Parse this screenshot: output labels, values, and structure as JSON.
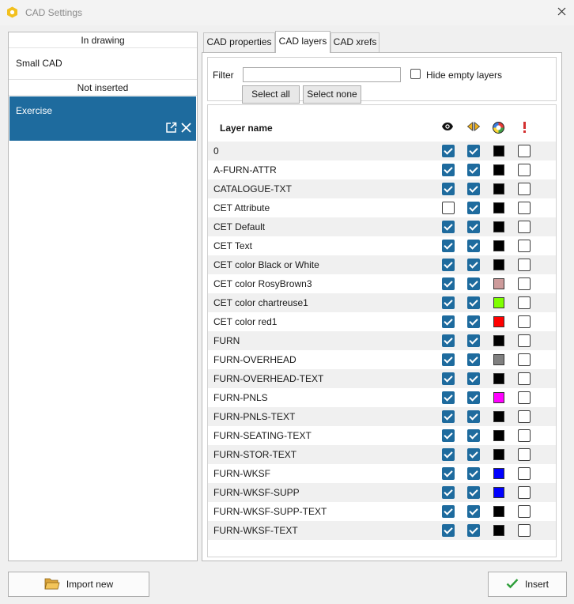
{
  "window": {
    "title": "CAD Settings",
    "icon": "hexagon-app-icon"
  },
  "left_panel": {
    "sections": [
      {
        "header": "In drawing",
        "items": [
          "Small CAD"
        ]
      },
      {
        "header": "Not inserted",
        "selected_item": "Exercise"
      }
    ],
    "selected_actions": [
      "external-link-icon",
      "close-icon"
    ]
  },
  "tabs": [
    {
      "label": "CAD properties",
      "active": false
    },
    {
      "label": "CAD layers",
      "active": true
    },
    {
      "label": "CAD xrefs",
      "active": false
    }
  ],
  "filter": {
    "label": "Filter",
    "value": "",
    "hide_empty_label": "Hide empty layers",
    "hide_empty_checked": false,
    "select_all_label": "Select all",
    "select_none_label": "Select none"
  },
  "layer_table": {
    "header_name": "Layer name",
    "header_icons": [
      "eye-icon",
      "freeze-icon",
      "color-wheel-icon",
      "warning-icon"
    ],
    "rows": [
      {
        "name": "0",
        "visible": true,
        "frozen": true,
        "color": "#000000",
        "warn": false
      },
      {
        "name": "A-FURN-ATTR",
        "visible": true,
        "frozen": true,
        "color": "#000000",
        "warn": false
      },
      {
        "name": "CATALOGUE-TXT",
        "visible": true,
        "frozen": true,
        "color": "#000000",
        "warn": false
      },
      {
        "name": "CET Attribute",
        "visible": false,
        "frozen": true,
        "color": "#000000",
        "warn": false
      },
      {
        "name": "CET Default",
        "visible": true,
        "frozen": true,
        "color": "#000000",
        "warn": false
      },
      {
        "name": "CET Text",
        "visible": true,
        "frozen": true,
        "color": "#000000",
        "warn": false
      },
      {
        "name": "CET color Black or White",
        "visible": true,
        "frozen": true,
        "color": "#000000",
        "warn": false
      },
      {
        "name": "CET color RosyBrown3",
        "visible": true,
        "frozen": true,
        "color": "#cd9b9b",
        "warn": false
      },
      {
        "name": "CET color chartreuse1",
        "visible": true,
        "frozen": true,
        "color": "#7fff00",
        "warn": false
      },
      {
        "name": "CET color red1",
        "visible": true,
        "frozen": true,
        "color": "#ff0000",
        "warn": false
      },
      {
        "name": "FURN",
        "visible": true,
        "frozen": true,
        "color": "#000000",
        "warn": false
      },
      {
        "name": "FURN-OVERHEAD",
        "visible": true,
        "frozen": true,
        "color": "#808080",
        "warn": false
      },
      {
        "name": "FURN-OVERHEAD-TEXT",
        "visible": true,
        "frozen": true,
        "color": "#000000",
        "warn": false
      },
      {
        "name": "FURN-PNLS",
        "visible": true,
        "frozen": true,
        "color": "#ff00ff",
        "warn": false
      },
      {
        "name": "FURN-PNLS-TEXT",
        "visible": true,
        "frozen": true,
        "color": "#000000",
        "warn": false
      },
      {
        "name": "FURN-SEATING-TEXT",
        "visible": true,
        "frozen": true,
        "color": "#000000",
        "warn": false
      },
      {
        "name": "FURN-STOR-TEXT",
        "visible": true,
        "frozen": true,
        "color": "#000000",
        "warn": false
      },
      {
        "name": "FURN-WKSF",
        "visible": true,
        "frozen": true,
        "color": "#0000ff",
        "warn": false
      },
      {
        "name": "FURN-WKSF-SUPP",
        "visible": true,
        "frozen": true,
        "color": "#0000ff",
        "warn": false
      },
      {
        "name": "FURN-WKSF-SUPP-TEXT",
        "visible": true,
        "frozen": true,
        "color": "#000000",
        "warn": false
      },
      {
        "name": "FURN-WKSF-TEXT",
        "visible": true,
        "frozen": true,
        "color": "#000000",
        "warn": false
      }
    ]
  },
  "footer": {
    "import_label": "Import new",
    "import_icon": "folder-icon",
    "insert_label": "Insert",
    "insert_icon": "checkmark-icon"
  },
  "colors": {
    "accent": "#1e6b9e",
    "row_alt": "#f0f0f0"
  }
}
